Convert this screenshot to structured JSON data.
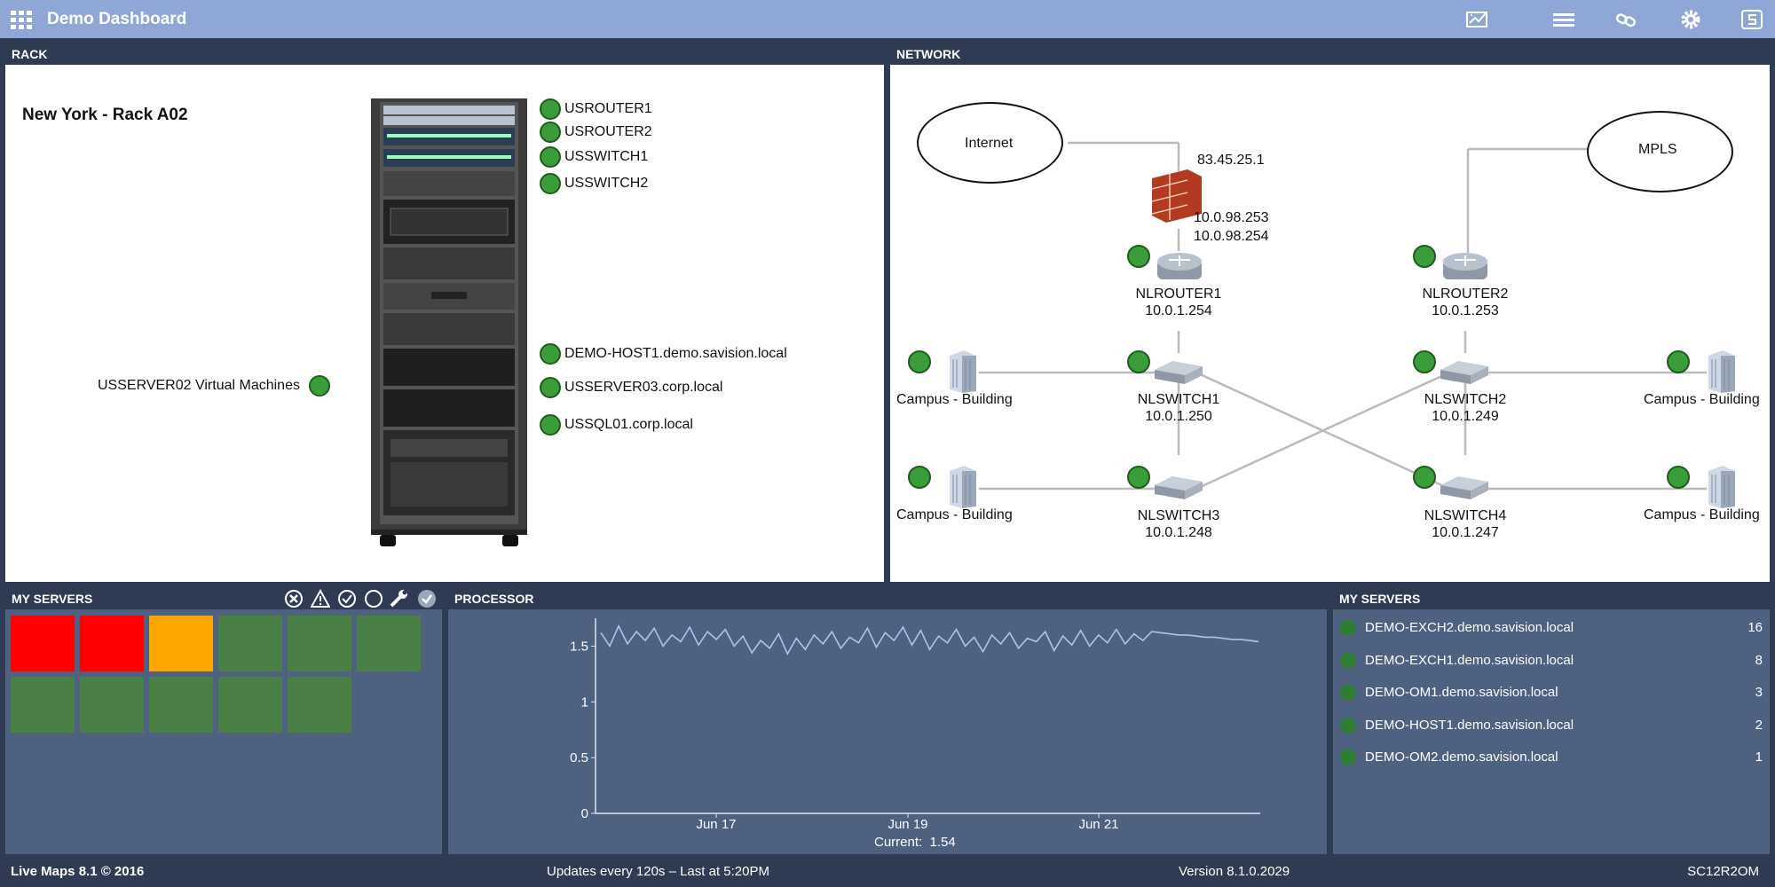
{
  "app": {
    "title": "Demo Dashboard"
  },
  "toolbar": {
    "icons": [
      "chart-edit-icon",
      "list-icon",
      "link-icon",
      "gear-icon",
      "savision-icon"
    ]
  },
  "rack": {
    "header": "RACK",
    "title": "New York - Rack A02",
    "devices": [
      {
        "name": "USROUTER1"
      },
      {
        "name": "USROUTER2"
      },
      {
        "name": "USSWITCH1"
      },
      {
        "name": "USSWITCH2"
      },
      {
        "name": "DEMO-HOST1.demo.savision.local"
      },
      {
        "name": "USSERVER03.corp.local"
      },
      {
        "name": "USSQL01.corp.local"
      }
    ],
    "vm_label": "USSERVER02 Virtual Machines"
  },
  "network": {
    "header": "NETWORK",
    "clouds": {
      "internet": "Internet",
      "mpls": "MPLS"
    },
    "firewall": {
      "ip_public": "83.45.25.1",
      "ip1": "10.0.98.253",
      "ip2": "10.0.98.254"
    },
    "routers": [
      {
        "name": "NLROUTER1",
        "ip": "10.0.1.254"
      },
      {
        "name": "NLROUTER2",
        "ip": "10.0.1.253"
      }
    ],
    "switches": [
      {
        "name": "NLSWITCH1",
        "ip": "10.0.1.250"
      },
      {
        "name": "NLSWITCH2",
        "ip": "10.0.1.249"
      },
      {
        "name": "NLSWITCH3",
        "ip": "10.0.1.248"
      },
      {
        "name": "NLSWITCH4",
        "ip": "10.0.1.247"
      }
    ],
    "buildings": [
      "Campus - Building",
      "Campus - Building",
      "Campus - Building",
      "Campus - Building"
    ]
  },
  "my_servers_tiles": {
    "header": "MY SERVERS",
    "filter_icons": [
      "close-circle-icon",
      "warning-icon",
      "check-circle-icon",
      "circle-icon",
      "wrench-icon",
      "check-filled-icon"
    ],
    "tiles": [
      "critical",
      "critical",
      "warning",
      "healthy",
      "healthy",
      "healthy",
      "healthy",
      "healthy",
      "healthy",
      "healthy",
      "healthy"
    ],
    "colors": {
      "critical": "#ff0000",
      "warning": "#ffa500",
      "healthy": "#4a7f45"
    }
  },
  "processor": {
    "header": "PROCESSOR",
    "current_label": "Current:  1.54"
  },
  "chart_data": {
    "type": "line",
    "title": "",
    "xlabel": "",
    "ylabel": "",
    "ylim": [
      0,
      1.75
    ],
    "yticks": [
      "0",
      "0.5",
      "1",
      "1.5"
    ],
    "xticks": [
      "Jun 17",
      "Jun 19",
      "Jun 21"
    ],
    "series": [
      {
        "values": [
          1.62,
          1.5,
          1.68,
          1.52,
          1.63,
          1.55,
          1.66,
          1.5,
          1.6,
          1.54,
          1.67,
          1.51,
          1.63,
          1.56,
          1.65,
          1.5,
          1.59,
          1.44,
          1.55,
          1.48,
          1.61,
          1.43,
          1.57,
          1.47,
          1.6,
          1.52,
          1.63,
          1.48,
          1.58,
          1.53,
          1.66,
          1.49,
          1.62,
          1.55,
          1.67,
          1.51,
          1.64,
          1.47,
          1.59,
          1.53,
          1.65,
          1.5,
          1.58,
          1.45,
          1.6,
          1.52,
          1.62,
          1.48,
          1.57,
          1.54,
          1.63,
          1.46,
          1.59,
          1.51,
          1.64,
          1.5,
          1.6,
          1.53,
          1.65,
          1.52,
          1.61,
          1.55,
          1.63,
          1.62,
          1.61,
          1.6,
          1.6,
          1.59,
          1.58,
          1.58,
          1.57,
          1.56,
          1.56,
          1.55,
          1.54
        ]
      }
    ]
  },
  "my_servers_list": {
    "header": "MY SERVERS",
    "rows": [
      {
        "name": "DEMO-EXCH2.demo.savision.local",
        "count": "16"
      },
      {
        "name": "DEMO-EXCH1.demo.savision.local",
        "count": "8"
      },
      {
        "name": "DEMO-OM1.demo.savision.local",
        "count": "3"
      },
      {
        "name": "DEMO-HOST1.demo.savision.local",
        "count": "2"
      },
      {
        "name": "DEMO-OM2.demo.savision.local",
        "count": "1"
      }
    ]
  },
  "footer": {
    "product": "Live Maps 8.1 © 2016",
    "updates": "Updates every 120s – Last at 5:20PM",
    "version": "Version 8.1.0.2029",
    "server": "SC12R2OM"
  }
}
